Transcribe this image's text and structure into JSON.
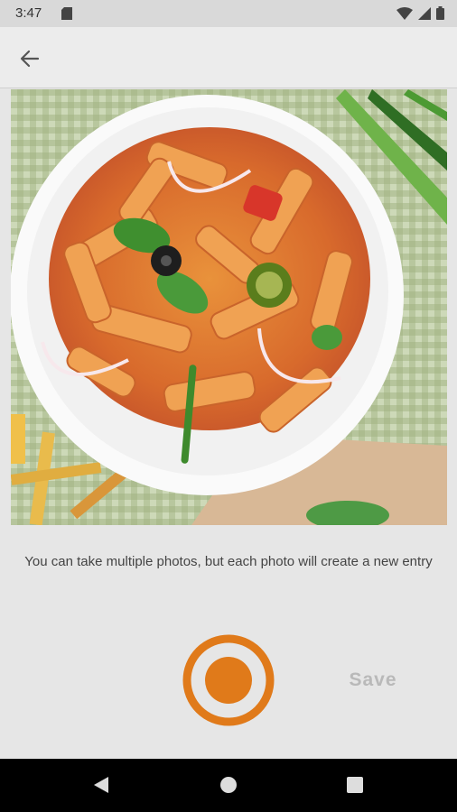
{
  "status_bar": {
    "time": "3:47",
    "icons": [
      "sd-card-icon",
      "wifi-icon",
      "signal-icon",
      "battery-icon"
    ]
  },
  "app_bar": {
    "back_icon": "arrow-back-icon"
  },
  "photo": {
    "description_icon": "food-photo"
  },
  "hint": {
    "text": "You can take multiple photos, but each photo will create a new entry"
  },
  "camera": {
    "shutter_icon": "shutter-icon",
    "save_label": "Save"
  },
  "colors": {
    "accent": "#e07a1a",
    "save_disabled": "#b9b9b9",
    "background": "#e6e6e6"
  },
  "nav_bar": {
    "icons": [
      "nav-back-icon",
      "nav-home-icon",
      "nav-recents-icon"
    ]
  }
}
